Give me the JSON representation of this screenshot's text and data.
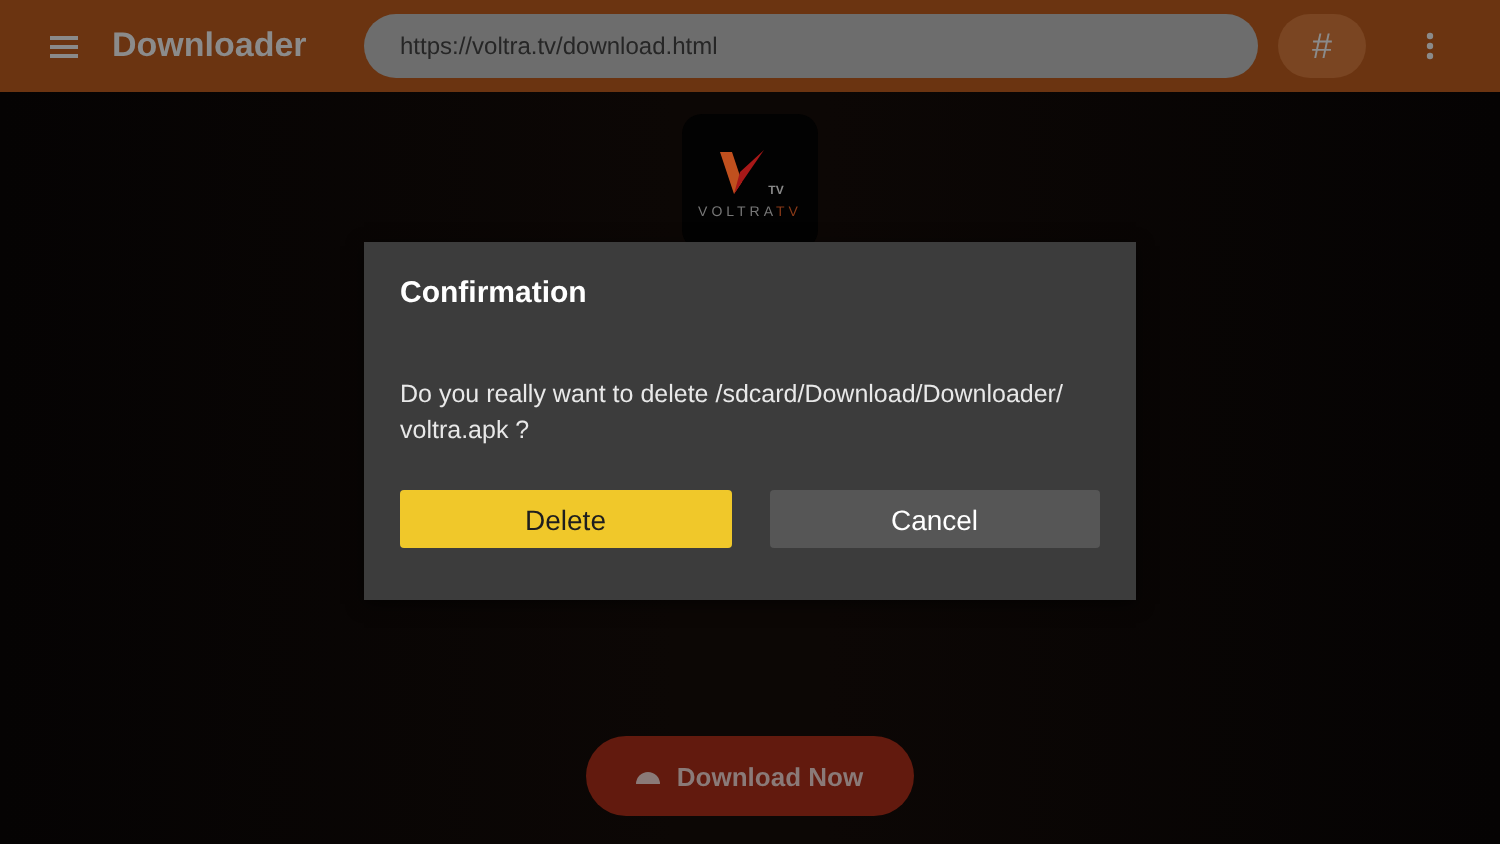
{
  "app_bar": {
    "title": "Downloader",
    "url": "https://voltra.tv/download.html",
    "hash_button": "#"
  },
  "app_logo": {
    "badge": "TV",
    "wordmark": "VOLTRA",
    "wordmark_suffix": "TV"
  },
  "download_button": {
    "label": "Download Now"
  },
  "dialog": {
    "title": "Confirmation",
    "message": "Do you really want to delete /sdcard/Download/Downloader/ voltra.apk ?",
    "buttons": [
      {
        "label": "Delete",
        "selected": true
      },
      {
        "label": "Cancel",
        "selected": false
      }
    ]
  }
}
